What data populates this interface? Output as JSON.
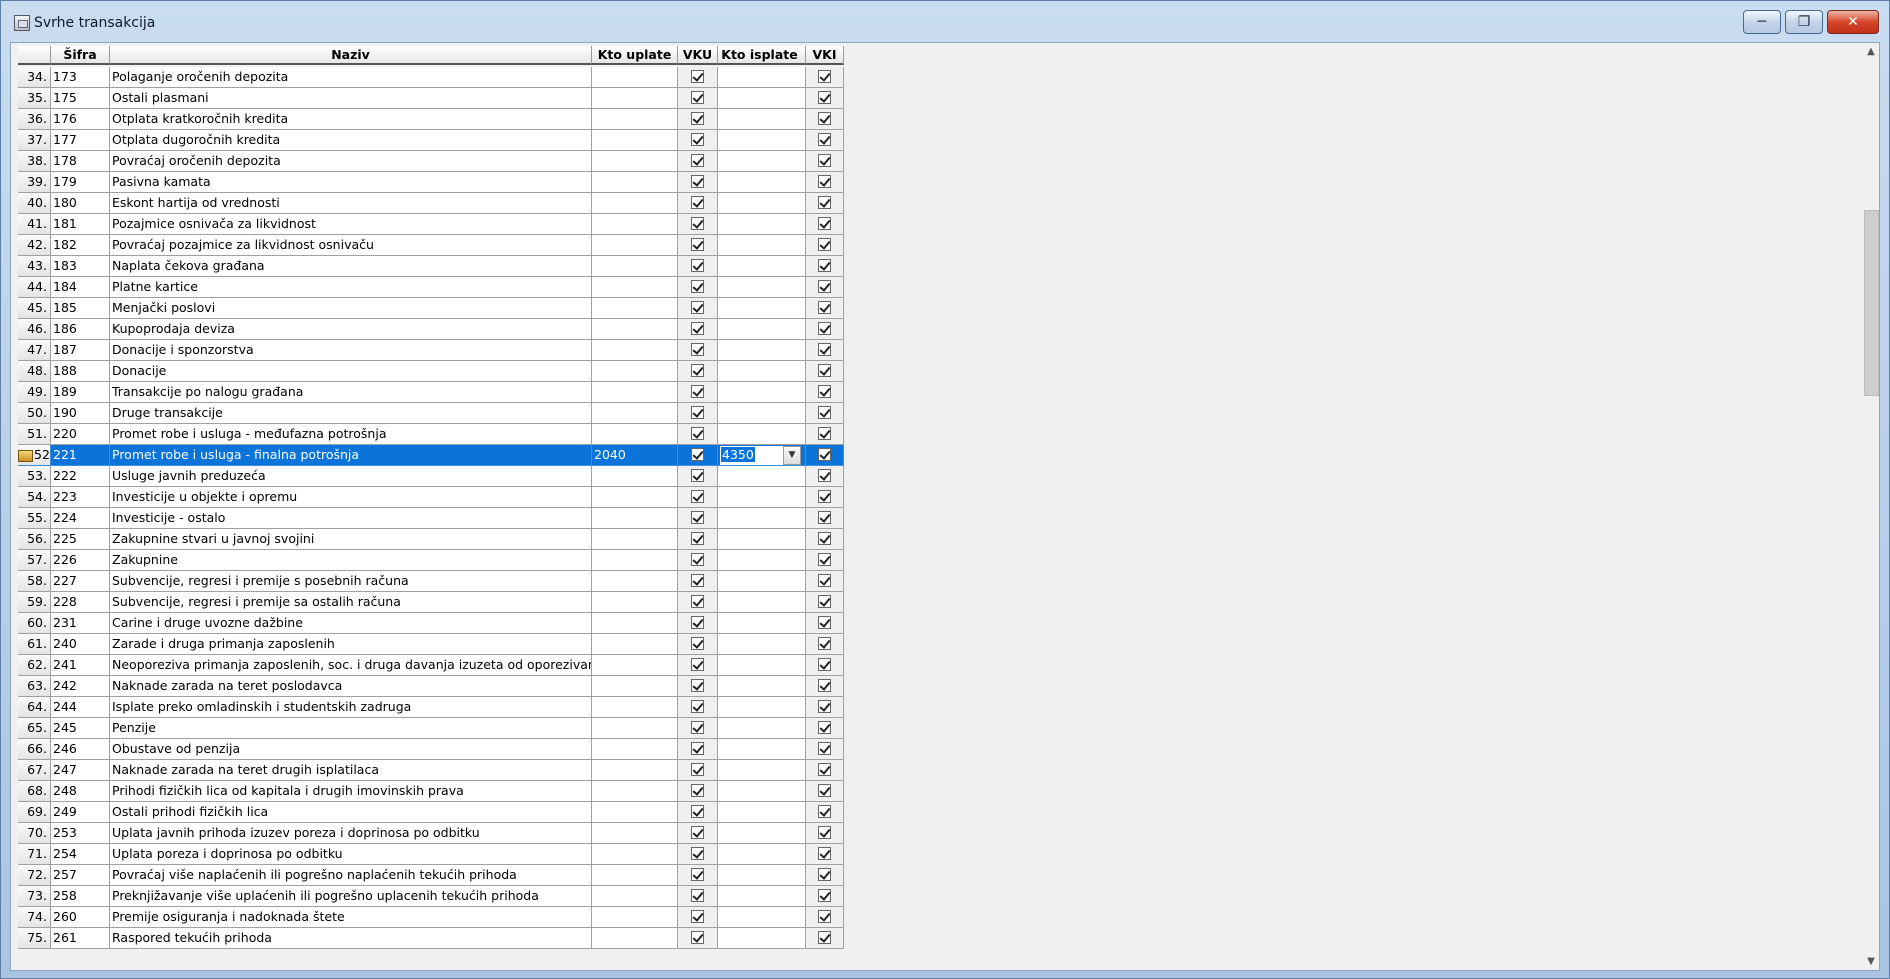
{
  "window": {
    "title": "Svrhe transakcija",
    "minimize": "─",
    "maximize": "❐",
    "close": "✕"
  },
  "columns": {
    "sifra": "Šifra",
    "naziv": "Naziv",
    "kto_uplate": "Kto uplate",
    "vku": "VKU",
    "kto_isplate": "Kto isplate",
    "vki": "VKI"
  },
  "rows": [
    {
      "num": "34.",
      "sifra": "173",
      "naziv": "Polaganje oročenih depozita",
      "kto_uplate": "",
      "vku": true,
      "kto_isplate": "",
      "vki": true
    },
    {
      "num": "35.",
      "sifra": "175",
      "naziv": "Ostali plasmani",
      "kto_uplate": "",
      "vku": true,
      "kto_isplate": "",
      "vki": true
    },
    {
      "num": "36.",
      "sifra": "176",
      "naziv": "Otplata kratkoročnih kredita",
      "kto_uplate": "",
      "vku": true,
      "kto_isplate": "",
      "vki": true
    },
    {
      "num": "37.",
      "sifra": "177",
      "naziv": "Otplata  dugoročnih kredita",
      "kto_uplate": "",
      "vku": true,
      "kto_isplate": "",
      "vki": true
    },
    {
      "num": "38.",
      "sifra": "178",
      "naziv": "Povraćaj oročenih depozita",
      "kto_uplate": "",
      "vku": true,
      "kto_isplate": "",
      "vki": true
    },
    {
      "num": "39.",
      "sifra": "179",
      "naziv": "Pasivna kamata",
      "kto_uplate": "",
      "vku": true,
      "kto_isplate": "",
      "vki": true
    },
    {
      "num": "40.",
      "sifra": "180",
      "naziv": "Eskont hartija od vrednosti",
      "kto_uplate": "",
      "vku": true,
      "kto_isplate": "",
      "vki": true
    },
    {
      "num": "41.",
      "sifra": "181",
      "naziv": "Pozajmice osnivača za likvidnost",
      "kto_uplate": "",
      "vku": true,
      "kto_isplate": "",
      "vki": true
    },
    {
      "num": "42.",
      "sifra": "182",
      "naziv": "Povraćaj pozajmice za likvidnost osnivaču",
      "kto_uplate": "",
      "vku": true,
      "kto_isplate": "",
      "vki": true
    },
    {
      "num": "43.",
      "sifra": "183",
      "naziv": "Naplata čekova građana",
      "kto_uplate": "",
      "vku": true,
      "kto_isplate": "",
      "vki": true
    },
    {
      "num": "44.",
      "sifra": "184",
      "naziv": "Platne kartice",
      "kto_uplate": "",
      "vku": true,
      "kto_isplate": "",
      "vki": true
    },
    {
      "num": "45.",
      "sifra": "185",
      "naziv": "Menjački poslovi",
      "kto_uplate": "",
      "vku": true,
      "kto_isplate": "",
      "vki": true
    },
    {
      "num": "46.",
      "sifra": "186",
      "naziv": "Kupoprodaja deviza",
      "kto_uplate": "",
      "vku": true,
      "kto_isplate": "",
      "vki": true
    },
    {
      "num": "47.",
      "sifra": "187",
      "naziv": "Donacije i sponzorstva",
      "kto_uplate": "",
      "vku": true,
      "kto_isplate": "",
      "vki": true
    },
    {
      "num": "48.",
      "sifra": "188",
      "naziv": "Donacije",
      "kto_uplate": "",
      "vku": true,
      "kto_isplate": "",
      "vki": true
    },
    {
      "num": "49.",
      "sifra": "189",
      "naziv": "Transakcije po nalogu građana",
      "kto_uplate": "",
      "vku": true,
      "kto_isplate": "",
      "vki": true
    },
    {
      "num": "50.",
      "sifra": "190",
      "naziv": "Druge transakcije",
      "kto_uplate": "",
      "vku": true,
      "kto_isplate": "",
      "vki": true
    },
    {
      "num": "51.",
      "sifra": "220",
      "naziv": "Promet robe i usluga - međufazna potrošnja",
      "kto_uplate": "",
      "vku": true,
      "kto_isplate": "",
      "vki": true
    },
    {
      "num": "52.",
      "sifra": "221",
      "naziv": "Promet robe i usluga - finalna potrošnja",
      "kto_uplate": "2040",
      "vku": true,
      "kto_isplate": "4350",
      "vki": true,
      "selected": true
    },
    {
      "num": "53.",
      "sifra": "222",
      "naziv": "Usluge javnih preduzeća",
      "kto_uplate": "",
      "vku": true,
      "kto_isplate": "",
      "vki": true
    },
    {
      "num": "54.",
      "sifra": "223",
      "naziv": "Investicije u objekte i opremu",
      "kto_uplate": "",
      "vku": true,
      "kto_isplate": "",
      "vki": true
    },
    {
      "num": "55.",
      "sifra": "224",
      "naziv": "Investicije - ostalo",
      "kto_uplate": "",
      "vku": true,
      "kto_isplate": "",
      "vki": true
    },
    {
      "num": "56.",
      "sifra": "225",
      "naziv": "Zakupnine stvari u javnoj svojini",
      "kto_uplate": "",
      "vku": true,
      "kto_isplate": "",
      "vki": true
    },
    {
      "num": "57.",
      "sifra": "226",
      "naziv": "Zakupnine",
      "kto_uplate": "",
      "vku": true,
      "kto_isplate": "",
      "vki": true
    },
    {
      "num": "58.",
      "sifra": "227",
      "naziv": "Subvencije, regresi i premije s posebnih računa",
      "kto_uplate": "",
      "vku": true,
      "kto_isplate": "",
      "vki": true
    },
    {
      "num": "59.",
      "sifra": "228",
      "naziv": "Subvencije, regresi i premije sa ostalih računa",
      "kto_uplate": "",
      "vku": true,
      "kto_isplate": "",
      "vki": true
    },
    {
      "num": "60.",
      "sifra": "231",
      "naziv": "Carine i druge uvozne dažbine",
      "kto_uplate": "",
      "vku": true,
      "kto_isplate": "",
      "vki": true
    },
    {
      "num": "61.",
      "sifra": "240",
      "naziv": "Zarade i druga primanja zaposlenih",
      "kto_uplate": "",
      "vku": true,
      "kto_isplate": "",
      "vki": true
    },
    {
      "num": "62.",
      "sifra": "241",
      "naziv": "Neoporeziva primanja zaposlenih, soc. i druga davanja izuzeta od oporezivanja i ob",
      "kto_uplate": "",
      "vku": true,
      "kto_isplate": "",
      "vki": true
    },
    {
      "num": "63.",
      "sifra": "242",
      "naziv": "Naknade zarada na teret poslodavca",
      "kto_uplate": "",
      "vku": true,
      "kto_isplate": "",
      "vki": true
    },
    {
      "num": "64.",
      "sifra": "244",
      "naziv": "Isplate preko omladinskih i studentskih zadruga",
      "kto_uplate": "",
      "vku": true,
      "kto_isplate": "",
      "vki": true
    },
    {
      "num": "65.",
      "sifra": "245",
      "naziv": "Penzije",
      "kto_uplate": "",
      "vku": true,
      "kto_isplate": "",
      "vki": true
    },
    {
      "num": "66.",
      "sifra": "246",
      "naziv": "Obustave od penzija",
      "kto_uplate": "",
      "vku": true,
      "kto_isplate": "",
      "vki": true
    },
    {
      "num": "67.",
      "sifra": "247",
      "naziv": "Naknade zarada na teret drugih isplatilaca",
      "kto_uplate": "",
      "vku": true,
      "kto_isplate": "",
      "vki": true
    },
    {
      "num": "68.",
      "sifra": "248",
      "naziv": "Prihodi fizičkih lica od kapitala i drugih imovinskih prava",
      "kto_uplate": "",
      "vku": true,
      "kto_isplate": "",
      "vki": true
    },
    {
      "num": "69.",
      "sifra": "249",
      "naziv": "Ostali prihodi fizičkih lica",
      "kto_uplate": "",
      "vku": true,
      "kto_isplate": "",
      "vki": true
    },
    {
      "num": "70.",
      "sifra": "253",
      "naziv": "Uplata javnih prihoda izuzev poreza i doprinosa po odbitku",
      "kto_uplate": "",
      "vku": true,
      "kto_isplate": "",
      "vki": true
    },
    {
      "num": "71.",
      "sifra": "254",
      "naziv": "Uplata poreza i doprinosa po odbitku",
      "kto_uplate": "",
      "vku": true,
      "kto_isplate": "",
      "vki": true
    },
    {
      "num": "72.",
      "sifra": "257",
      "naziv": "Povraćaj više naplaćenih ili pogrešno naplaćenih tekućih prihoda",
      "kto_uplate": "",
      "vku": true,
      "kto_isplate": "",
      "vki": true
    },
    {
      "num": "73.",
      "sifra": "258",
      "naziv": "Preknjižavanje više uplaćenih ili pogrešno uplacenih tekućih prihoda",
      "kto_uplate": "",
      "vku": true,
      "kto_isplate": "",
      "vki": true
    },
    {
      "num": "74.",
      "sifra": "260",
      "naziv": "Premije osiguranja i nadoknada štete",
      "kto_uplate": "",
      "vku": true,
      "kto_isplate": "",
      "vki": true
    },
    {
      "num": "75.",
      "sifra": "261",
      "naziv": "Raspored tekućih prihoda",
      "kto_uplate": "",
      "vku": true,
      "kto_isplate": "",
      "vki": true
    }
  ]
}
